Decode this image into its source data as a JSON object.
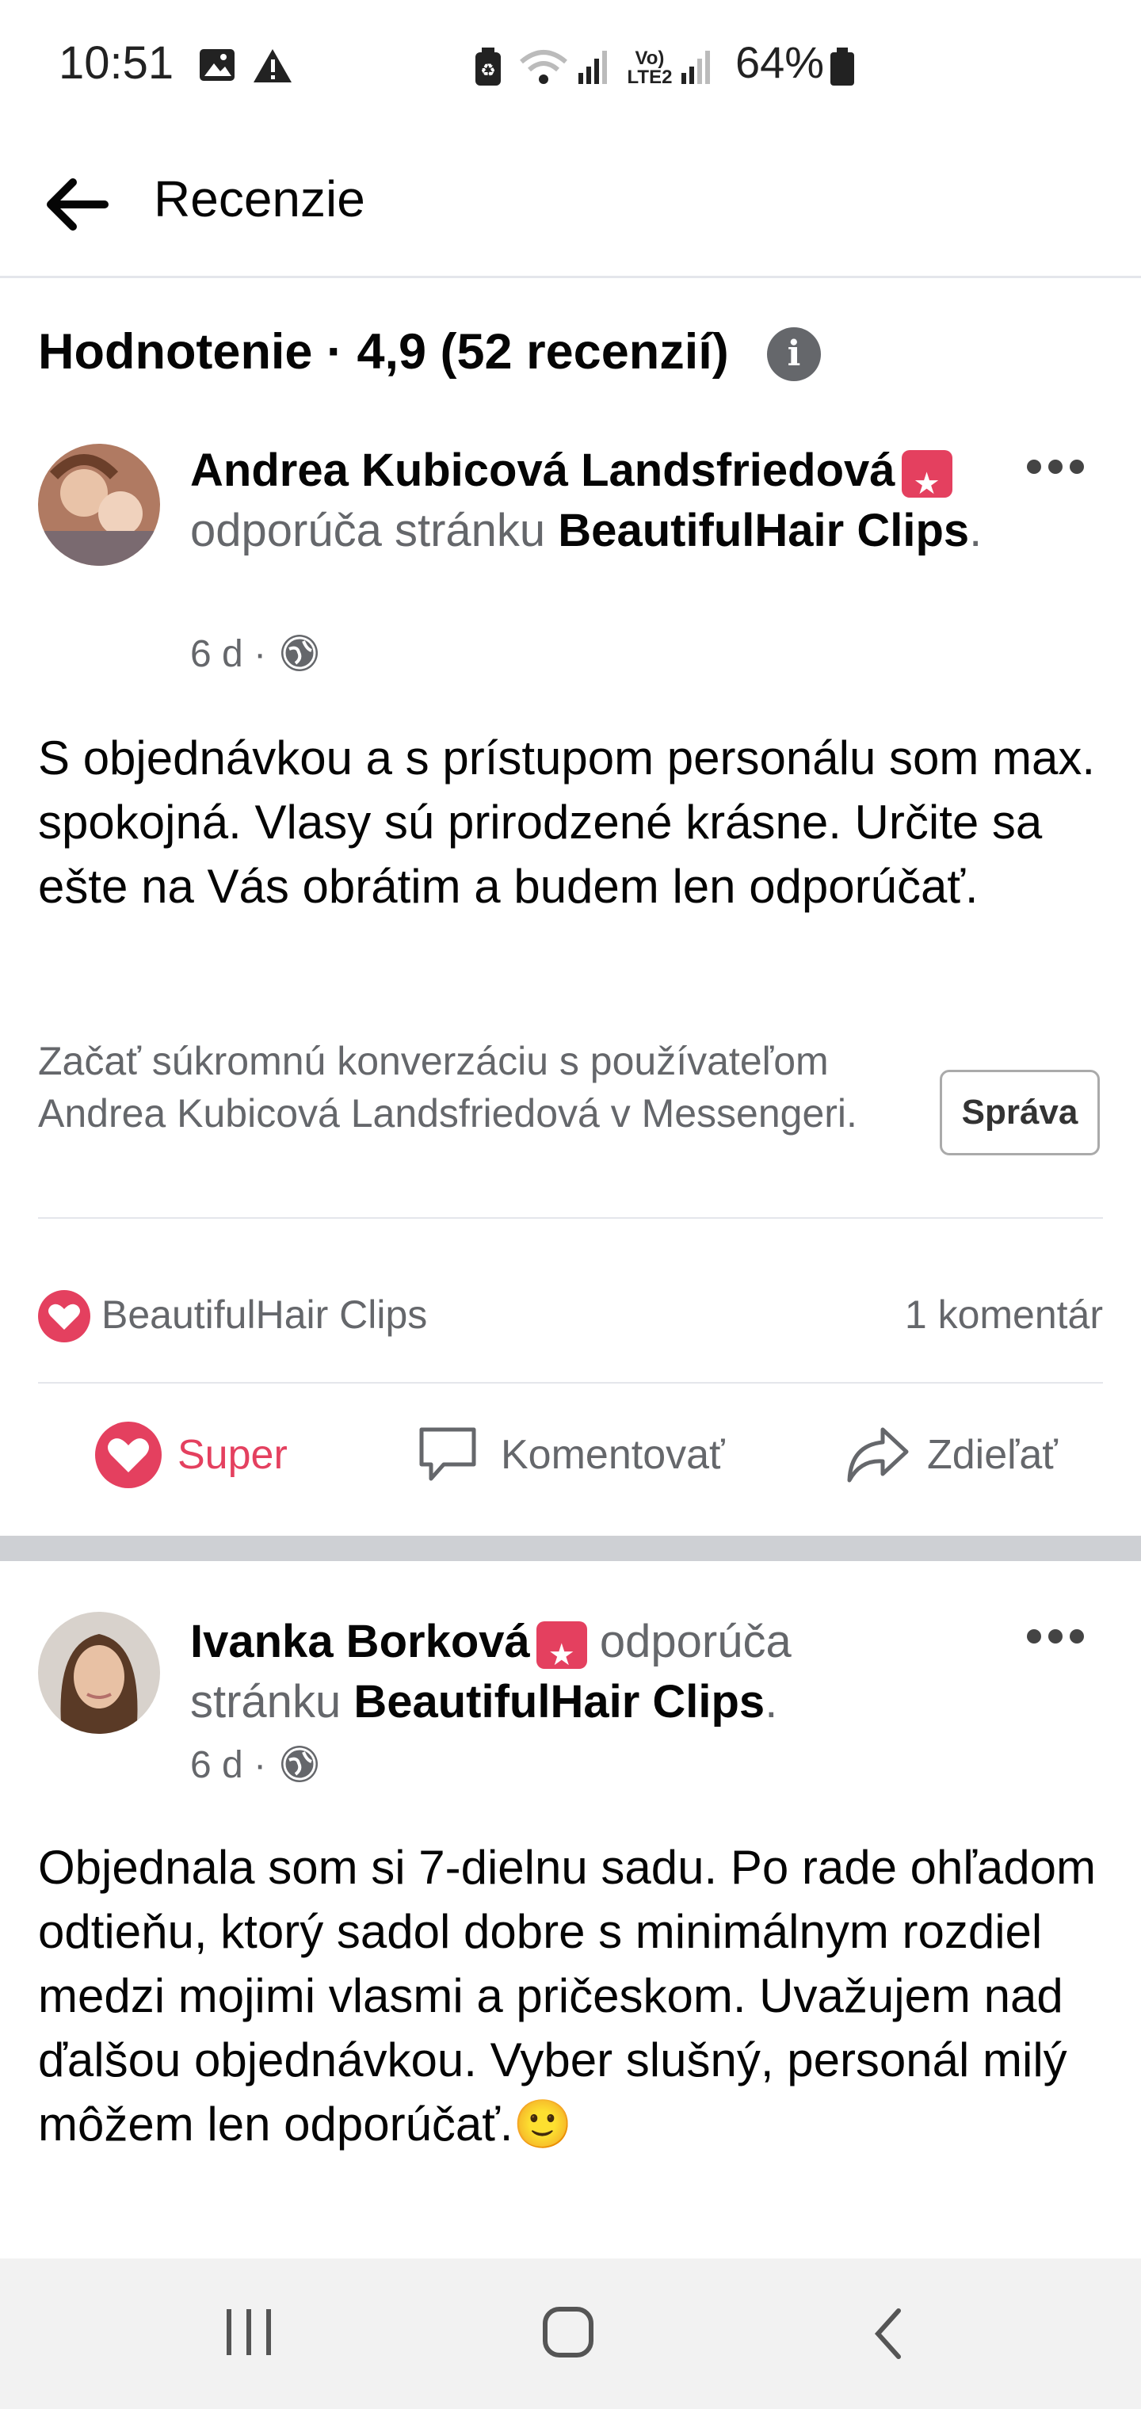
{
  "status_bar": {
    "time": "10:51",
    "battery": "64%",
    "network": "Vo) LTE2"
  },
  "header": {
    "title": "Recenzie"
  },
  "rating": {
    "text": "Hodnotenie · 4,9 (52 recenzií)"
  },
  "reviews": [
    {
      "name": "Andrea Kubicová Landsfriedová",
      "recommends": "odporúča stránku",
      "page": "BeautifulHair Clips",
      "meta": "6 d ·",
      "text": "S objednávkou a s prístupom personálu som max. spokojná. Vlasy sú prirodzené krásne. Určite sa ešte na Vás obrátim a budem len odporúčať.",
      "message_prompt": "Začať súkromnú konverzáciu s používateľom Andrea Kubicová Landsfriedová v Messengeri.",
      "message_button": "Správa",
      "reaction_by": "BeautifulHair Clips",
      "comments": "1 komentár"
    },
    {
      "name": "Ivanka Borková",
      "recommends_a": "odporúča",
      "recommends_b": "stránku",
      "page": "BeautifulHair Clips",
      "meta": "6 d ·",
      "text": "Objednala som si 7-dielnu sadu. Po rade ohľadom odtieňu, ktorý sadol dobre s minimálnym rozdiel medzi mojimi vlasmi a pričeskom. Uvažujem nad ďalšou objednávkou. Vyber slušný, personál milý môžem len odporúčať.",
      "emoji": "🙂"
    }
  ],
  "actions": {
    "like": "Super",
    "comment": "Komentovať",
    "share": "Zdieľať"
  },
  "colors": {
    "accent": "#e4405f",
    "muted": "#65676b",
    "divider": "#e4e6eb"
  }
}
